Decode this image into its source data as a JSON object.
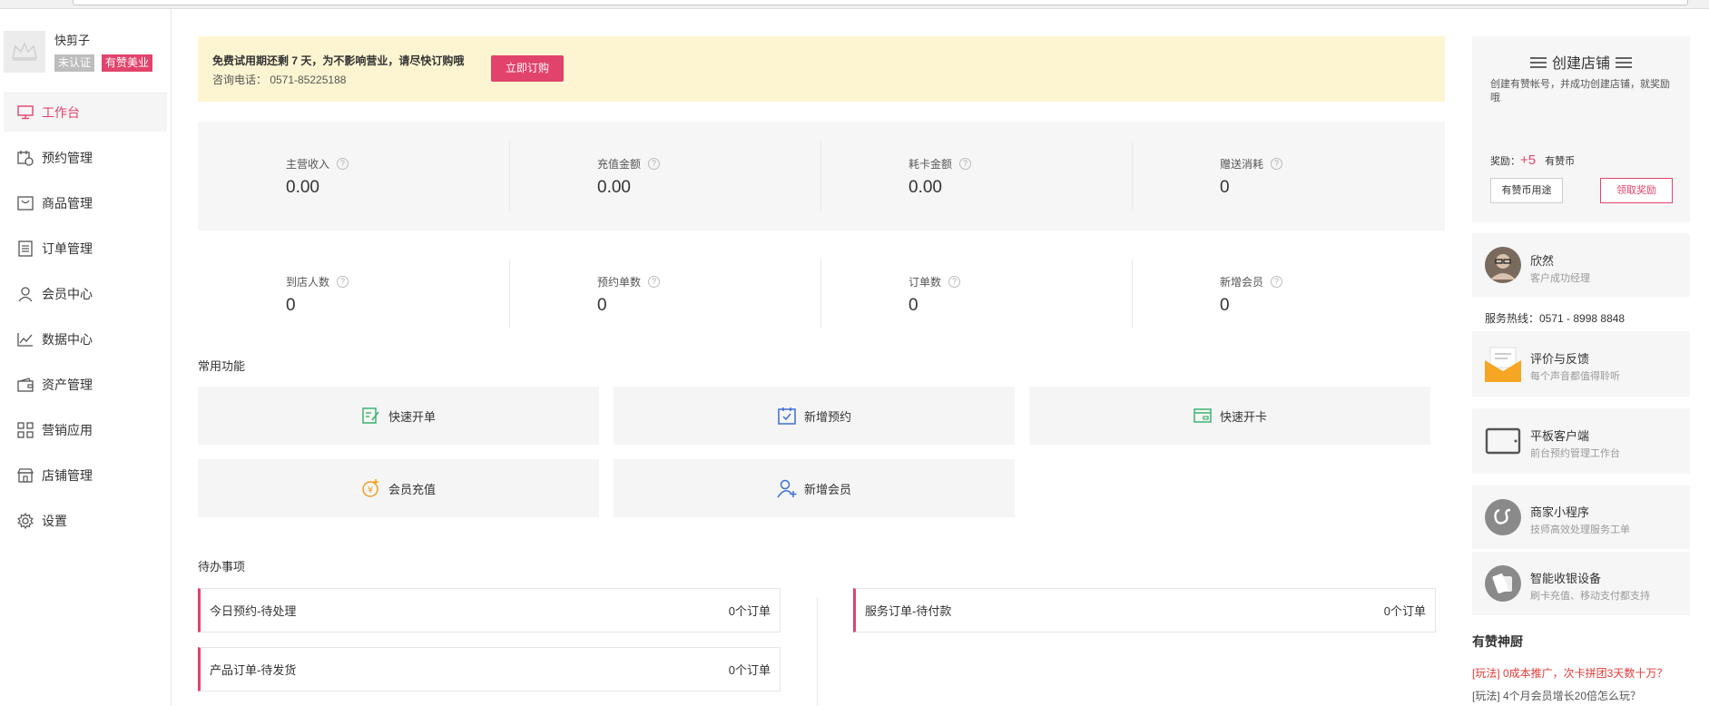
{
  "profile": {
    "name": "快剪子",
    "badge_unverified": "未认证",
    "badge_brand": "有赞美业"
  },
  "nav": [
    {
      "label": "工作台",
      "icon": "monitor-icon",
      "active": true
    },
    {
      "label": "预约管理",
      "icon": "calendar-icon"
    },
    {
      "label": "商品管理",
      "icon": "bag-icon"
    },
    {
      "label": "订单管理",
      "icon": "document-icon"
    },
    {
      "label": "会员中心",
      "icon": "user-icon"
    },
    {
      "label": "数据中心",
      "icon": "chart-icon"
    },
    {
      "label": "资产管理",
      "icon": "wallet-icon"
    },
    {
      "label": "营销应用",
      "icon": "apps-icon"
    },
    {
      "label": "店铺管理",
      "icon": "store-icon"
    },
    {
      "label": "设置",
      "icon": "gear-icon"
    }
  ],
  "trial": {
    "notice": "免费试用期还剩 7 天，为不影响营业，请尽快订购哦",
    "phone": "咨询电话： 0571-85225188",
    "subscribe_button": "立即订购"
  },
  "stats_row1": [
    {
      "label": "主营收入",
      "value": "0.00"
    },
    {
      "label": "充值金额",
      "value": "0.00"
    },
    {
      "label": "耗卡金额",
      "value": "0.00"
    },
    {
      "label": "赠送消耗",
      "value": "0"
    }
  ],
  "stats_row2": [
    {
      "label": "到店人数",
      "value": "0"
    },
    {
      "label": "预约单数",
      "value": "0"
    },
    {
      "label": "订单数",
      "value": "0"
    },
    {
      "label": "新增会员",
      "value": "0"
    }
  ],
  "common_functions": {
    "title": "常用功能",
    "items": [
      {
        "label": "快速开单",
        "icon": "quick-order-icon",
        "color": "#3cb371"
      },
      {
        "label": "新增预约",
        "icon": "calendar-check-icon",
        "color": "#3b6fd4"
      },
      {
        "label": "快速开卡",
        "icon": "card-icon",
        "color": "#3cb371"
      },
      {
        "label": "会员充值",
        "icon": "coin-plus-icon",
        "color": "#f0a020"
      },
      {
        "label": "新增会员",
        "icon": "user-plus-icon",
        "color": "#3b6fd4"
      }
    ]
  },
  "todos": {
    "title": "待办事项",
    "items": [
      {
        "label": "今日预约-待处理",
        "count": "0个订单"
      },
      {
        "label": "服务订单-待付款",
        "count": "0个订单"
      },
      {
        "label": "产品订单-待发货",
        "count": "0个订单"
      }
    ]
  },
  "create_store": {
    "title": "创建店铺",
    "desc": "创建有赞帐号，并成功创建店铺，就奖励哦",
    "reward_label": "奖励：",
    "reward_value": "+5",
    "reward_unit": "有赞币",
    "use_button": "有赞币用途",
    "claim_button": "领取奖励"
  },
  "manager": {
    "name": "欣然",
    "role": "客户成功经理",
    "hotline": "服务热线：0571 - 8998 8848"
  },
  "services": [
    {
      "title": "评价与反馈",
      "sub": "每个声音都值得聆听",
      "icon": "envelope-icon"
    },
    {
      "title": "平板客户端",
      "sub": "前台预约管理工作台",
      "icon": "tablet-icon"
    },
    {
      "title": "商家小程序",
      "sub": "技师高效处理服务工单",
      "icon": "miniprogram-icon"
    },
    {
      "title": "智能收银设备",
      "sub": "刷卡充值、移动支付都支持",
      "icon": "pos-icon"
    }
  ],
  "news": {
    "title": "有赞神厨",
    "items": [
      "[玩法] 0成本推广，次卡拼团3天数十万？",
      "[玩法] 4个月会员增长20倍怎么玩？"
    ]
  },
  "colors": {
    "accent": "#e2436c",
    "trial_bg": "#fdf5d1",
    "panel_bg": "#f6f6f6"
  }
}
